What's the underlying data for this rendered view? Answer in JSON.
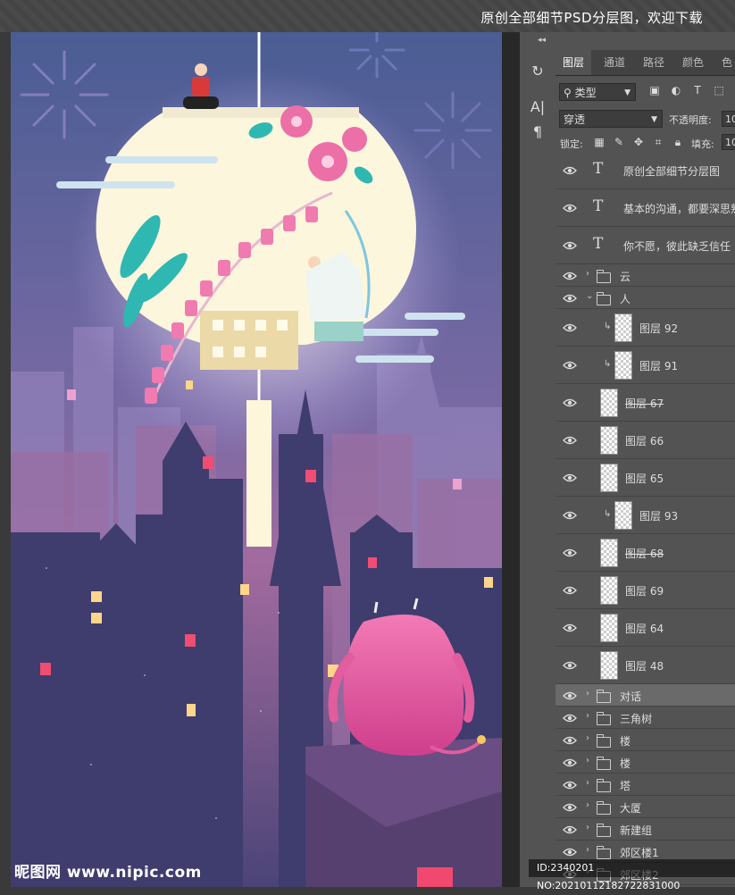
{
  "topbar": {
    "text": "原创全部细节PSD分层图，欢迎下载"
  },
  "panel": {
    "tabs": [
      "图层",
      "通道",
      "路径",
      "颜色",
      "色"
    ],
    "filter_label": "类型",
    "blend_mode": "穿透",
    "opacity_label": "不透明度:",
    "opacity_value": "10",
    "lock_label": "锁定:",
    "fill_label": "填充:",
    "fill_value": "10"
  },
  "layers": [
    {
      "kind": "text",
      "name": "原创全部细节分层图"
    },
    {
      "kind": "text",
      "name": "基本的沟通，都要深思熟"
    },
    {
      "kind": "text",
      "name": "你不愿，彼此缺乏信任"
    },
    {
      "kind": "group",
      "name": "云",
      "open": false
    },
    {
      "kind": "group",
      "name": "人",
      "open": true
    },
    {
      "kind": "pixel",
      "name": "图层 92",
      "clipped": true
    },
    {
      "kind": "pixel",
      "name": "图层 91",
      "clipped": true
    },
    {
      "kind": "pixel",
      "name": "图层 67",
      "strike": true
    },
    {
      "kind": "pixel",
      "name": "图层 66"
    },
    {
      "kind": "pixel",
      "name": "图层 65"
    },
    {
      "kind": "pixel",
      "name": "图层 93",
      "clipped": true
    },
    {
      "kind": "pixel",
      "name": "图层 68",
      "strike": true
    },
    {
      "kind": "pixel",
      "name": "图层 69"
    },
    {
      "kind": "pixel",
      "name": "图层 64"
    },
    {
      "kind": "pixel",
      "name": "图层 48"
    },
    {
      "kind": "group",
      "name": "对话",
      "open": false,
      "selected": true
    },
    {
      "kind": "group",
      "name": "三角树",
      "open": false
    },
    {
      "kind": "group",
      "name": "楼",
      "open": false
    },
    {
      "kind": "group",
      "name": "楼",
      "open": false
    },
    {
      "kind": "group",
      "name": "塔",
      "open": false
    },
    {
      "kind": "group",
      "name": "大厦",
      "open": false
    },
    {
      "kind": "group",
      "name": "新建组",
      "open": false
    },
    {
      "kind": "group",
      "name": "郊区楼1",
      "open": false
    },
    {
      "kind": "group",
      "name": "郊区楼2",
      "open": false
    }
  ],
  "watermark": {
    "brand": "昵图网",
    "url": "www.nipic.com"
  },
  "id_bar": {
    "text": "ID:2340201 NO:20210112182722831000"
  },
  "icons": [
    "history-icon",
    "character-icon",
    "paragraph-icon",
    "search-icon",
    "image-filter-icon",
    "adjustment-filter-icon",
    "type-filter-icon",
    "shape-filter-icon",
    "eye-icon",
    "folder-icon",
    "lock-transparent-icon",
    "lock-paint-icon",
    "lock-move-icon",
    "lock-artboard-icon",
    "lock-all-icon"
  ],
  "colors": {
    "sky_top": "#4a5d94",
    "sky_bottom": "#4b4477",
    "moon": "#fbf6dc",
    "accent_pink": "#ec6fa8"
  }
}
